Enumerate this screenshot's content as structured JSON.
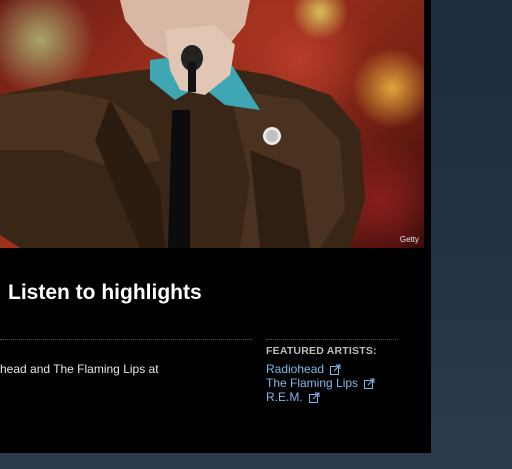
{
  "photo": {
    "credit": "Getty"
  },
  "section": {
    "heading": "Listen to highlights",
    "description": "head and The Flaming Lips at"
  },
  "featured": {
    "title": "FEATURED ARTISTS:",
    "artists": [
      {
        "name": "Radiohead",
        "icon": "external-link-icon"
      },
      {
        "name": "The Flaming Lips",
        "icon": "external-link-icon"
      },
      {
        "name": "R.E.M.",
        "icon": "external-link-icon"
      }
    ]
  },
  "colors": {
    "page_background": "#243447",
    "panel": "#000000",
    "heading_text": "#ffffff",
    "link": "#7fb7e8"
  }
}
